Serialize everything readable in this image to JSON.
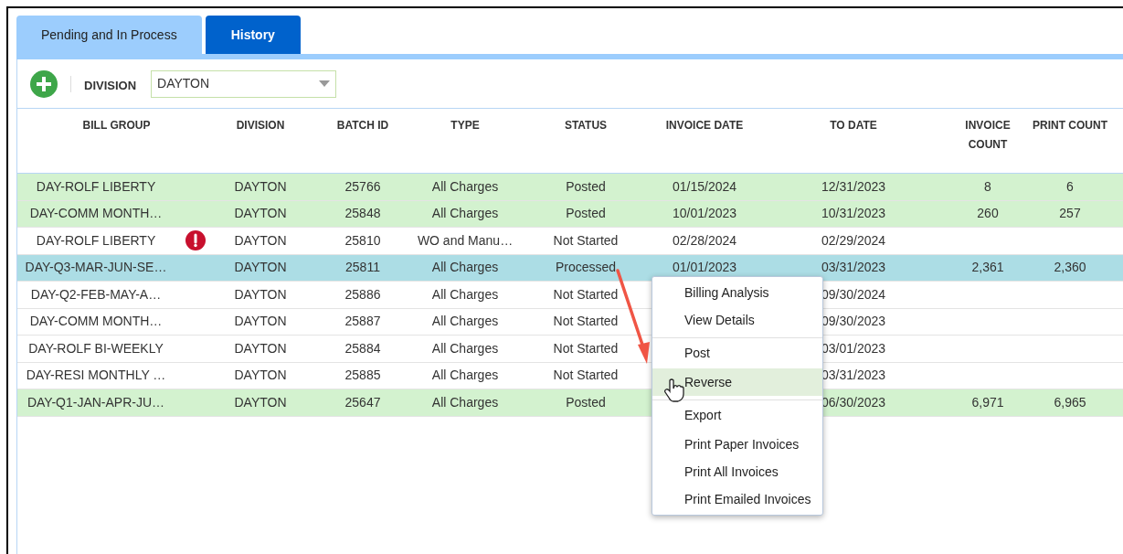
{
  "tabs": [
    {
      "label": "Pending and In Process",
      "selected": true
    },
    {
      "label": "History",
      "selected": false
    }
  ],
  "toolbar": {
    "division_label": "DIVISION",
    "division_value": "DAYTON"
  },
  "table": {
    "columns": [
      "BILL GROUP",
      "DIVISION",
      "BATCH ID",
      "TYPE",
      "STATUS",
      "INVOICE DATE",
      "TO DATE",
      "INVOICE COUNT",
      "PRINT COUNT"
    ],
    "rows": [
      {
        "cells": [
          "DAY-ROLF LIBERTY",
          "DAYTON",
          "25766",
          "All Charges",
          "Posted",
          "01/15/2024",
          "12/31/2023",
          "8",
          "6"
        ],
        "selected": false,
        "completed": true,
        "warning": false
      },
      {
        "cells": [
          "DAY-COMM MONTH…",
          "DAYTON",
          "25848",
          "All Charges",
          "Posted",
          "10/01/2023",
          "10/31/2023",
          "260",
          "257"
        ],
        "selected": false,
        "completed": true,
        "warning": false
      },
      {
        "cells": [
          "DAY-ROLF LIBERTY",
          "DAYTON",
          "25810",
          "WO and Manu…",
          "Not Started",
          "02/28/2024",
          "02/29/2024",
          "",
          ""
        ],
        "selected": false,
        "completed": false,
        "warning": true
      },
      {
        "cells": [
          "DAY-Q3-MAR-JUN-SE…",
          "DAYTON",
          "25811",
          "All Charges",
          "Processed",
          "01/01/2023",
          "03/31/2023",
          "2,361",
          "2,360"
        ],
        "selected": true,
        "completed": false,
        "warning": false
      },
      {
        "cells": [
          "DAY-Q2-FEB-MAY-A…",
          "DAYTON",
          "25886",
          "All Charges",
          "Not Started",
          "",
          "09/30/2024",
          "",
          ""
        ],
        "selected": false,
        "completed": false,
        "warning": false
      },
      {
        "cells": [
          "DAY-COMM MONTH…",
          "DAYTON",
          "25887",
          "All Charges",
          "Not Started",
          "",
          "09/30/2023",
          "",
          ""
        ],
        "selected": false,
        "completed": false,
        "warning": false
      },
      {
        "cells": [
          "DAY-ROLF BI-WEEKLY",
          "DAYTON",
          "25884",
          "All Charges",
          "Not Started",
          "",
          "03/01/2023",
          "",
          ""
        ],
        "selected": false,
        "completed": false,
        "warning": false
      },
      {
        "cells": [
          "DAY-RESI MONTHLY …",
          "DAYTON",
          "25885",
          "All Charges",
          "Not Started",
          "",
          "03/31/2023",
          "",
          ""
        ],
        "selected": false,
        "completed": false,
        "warning": false
      },
      {
        "cells": [
          "DAY-Q1-JAN-APR-JU…",
          "DAYTON",
          "25647",
          "All Charges",
          "Posted",
          "",
          "06/30/2023",
          "6,971",
          "6,965"
        ],
        "selected": false,
        "completed": true,
        "warning": false
      }
    ]
  },
  "context_menu": {
    "items": [
      {
        "label": "Billing Analysis",
        "hovered": false,
        "divider_before": false
      },
      {
        "label": "View Details",
        "hovered": false,
        "divider_before": false
      },
      {
        "label": "Post",
        "hovered": false,
        "divider_before": true
      },
      {
        "label": "Reverse",
        "hovered": true,
        "divider_before": false
      },
      {
        "label": "Export",
        "hovered": false,
        "divider_before": true
      },
      {
        "label": "Print Paper Invoices",
        "hovered": false,
        "divider_before": false
      },
      {
        "label": "Print All Invoices",
        "hovered": false,
        "divider_before": false
      },
      {
        "label": "Print Emailed Invoices",
        "hovered": false,
        "divider_before": false
      }
    ]
  }
}
